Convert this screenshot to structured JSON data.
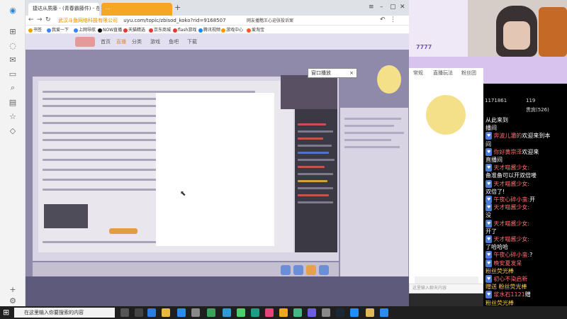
{
  "browser": {
    "tabs": [
      {
        "label": "捷达从质藤 - (青春霸藤件) - 在...",
        "active": true
      },
      {
        "label": "...",
        "active": false
      }
    ],
    "new_tab": "+",
    "address": {
      "warning": "武汉斗鱼网络科技有限公司",
      "url": "uyu.com/topic/zbisod_koko?rid=9168507",
      "search_hint": "网友播黯王心迎张投诉案"
    },
    "bookmarks": [
      "书签",
      "我爱一下",
      "上网导航",
      "NOW直播",
      "天猫精选",
      "京东商城",
      "flash游戏",
      "腾讯视频",
      "游戏中心",
      "爱淘宝"
    ]
  },
  "page": {
    "nav": [
      "首页",
      "直播",
      "分类",
      "游戏",
      "鱼吧",
      "下载"
    ],
    "close_webcam": "窗口播放",
    "close_x": "×"
  },
  "room": {
    "tabs": [
      "常规",
      "直播玩法",
      "粉丝团"
    ],
    "fans": "1171861",
    "stat2": "119",
    "vip": "贵宾(526)",
    "chat_input_placeholder": "这里输入聊天内容",
    "live_number": "7777"
  },
  "danmu": [
    {
      "nick": "",
      "text": "从此来到"
    },
    {
      "nick": "",
      "text": "播间"
    },
    {
      "nick": "奔波儿灞的",
      "text": "欢迎来到本"
    },
    {
      "nick": "",
      "text": "间"
    },
    {
      "nick": "你好黄宗泽",
      "text": "欢迎来"
    },
    {
      "nick": "",
      "text": "直播间"
    },
    {
      "nick": "天才喵酱少女:",
      "text": ""
    },
    {
      "nick": "",
      "text": "备准备可以开双倍喽"
    },
    {
      "nick": "天才喵酱少女:",
      "text": ""
    },
    {
      "nick": "",
      "text": "双倍了!"
    },
    {
      "nick": "午夜心碎小蛮:",
      "text": "开"
    },
    {
      "nick": "天才喵酱少女:",
      "text": ""
    },
    {
      "nick": "",
      "text": "没"
    },
    {
      "nick": "天才喵酱少女:",
      "text": ""
    },
    {
      "nick": "",
      "text": "开了"
    },
    {
      "nick": "天才喵酱少女:",
      "text": ""
    },
    {
      "nick": "",
      "text": "了哈哈哈"
    },
    {
      "nick": "午夜心碎小蛮:",
      "text": "?"
    },
    {
      "nick": "晚安夏发呆",
      "text": ""
    },
    {
      "nick": "",
      "text": "粉丝荧光棒"
    },
    {
      "nick": "初心不染启新",
      "text": ""
    },
    {
      "nick": "",
      "text": "赠送 粉丝荧光棒"
    },
    {
      "nick": "浆水石1121",
      "text": "赠"
    },
    {
      "nick": "",
      "text": "粉丝荧光棒"
    },
    {
      "nick": "一只傻呀呀",
      "text": "赠送"
    }
  ],
  "taskbar": {
    "search_placeholder": "在这里输入你要搜索的内容"
  },
  "colors": {
    "accent_orange": "#f5a623",
    "room_purple": "#d7c3ee",
    "danmu_nick": "#ff6f6f"
  }
}
